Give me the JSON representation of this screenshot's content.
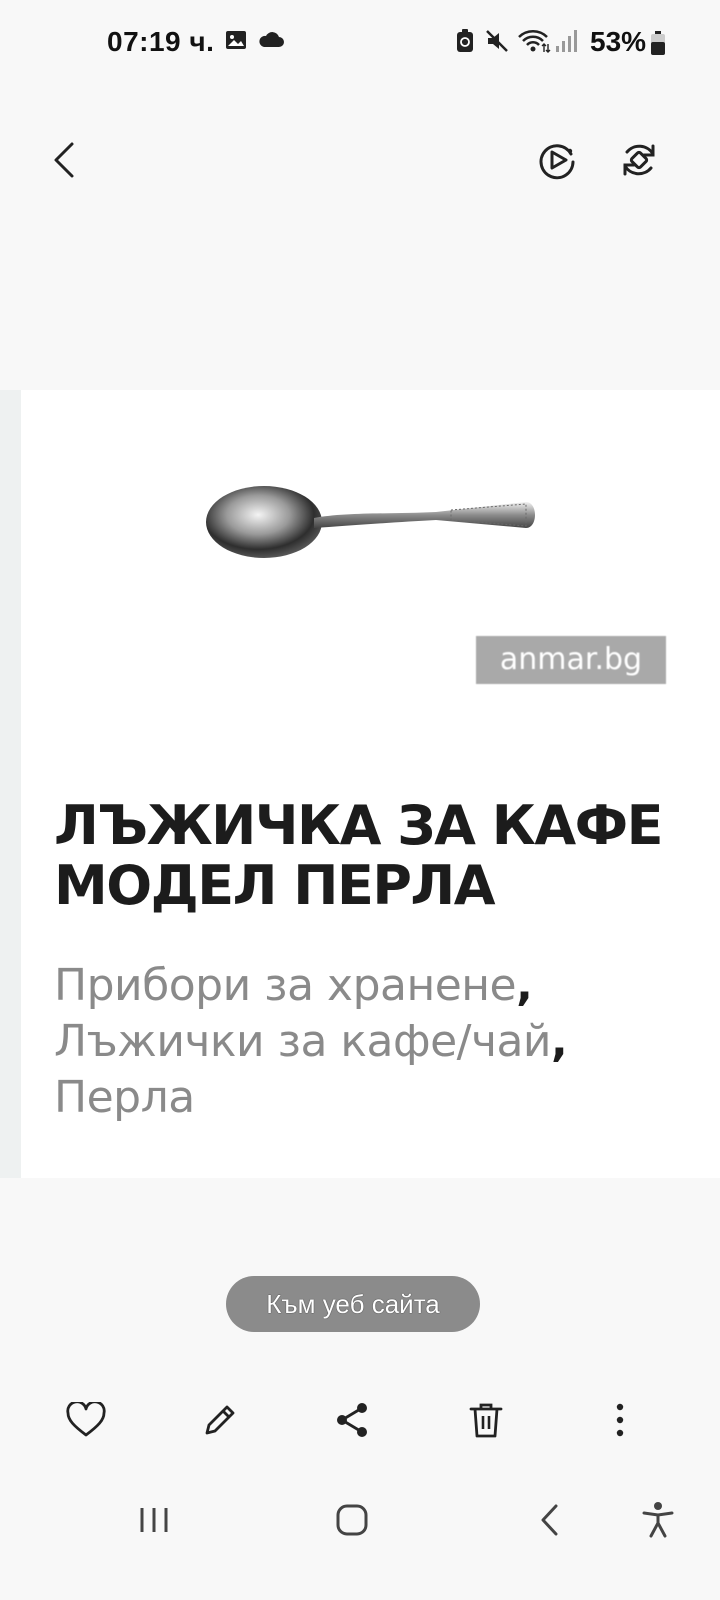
{
  "status_bar": {
    "time": "07:19 ч.",
    "battery_percent": "53%",
    "icons": [
      "gallery-icon",
      "cloud-icon",
      "battery-saver-icon",
      "mute-icon",
      "wifi-icon",
      "signal-icon",
      "battery-icon"
    ]
  },
  "top_bar": {
    "icons": [
      "back-icon",
      "motion-photo-icon",
      "rotate-icon"
    ]
  },
  "photo": {
    "watermark": "anmar.bg",
    "title_line1": "ЛЪЖИЧКА ЗА КАФЕ",
    "title_line2": "МОДЕЛ ПЕРЛА",
    "categories": [
      "Прибори за хранене",
      "Лъжички за кафе/чай",
      "Перла"
    ],
    "separator": ","
  },
  "web_button": {
    "label": "Към уеб сайта"
  },
  "actions": {
    "icons": [
      "favorite-icon",
      "edit-icon",
      "share-icon",
      "delete-icon",
      "more-icon"
    ]
  },
  "nav_bar": {
    "icons": [
      "recents-icon",
      "home-icon",
      "back-icon",
      "accessibility-icon"
    ]
  },
  "colors": {
    "background": "#f8f8f8",
    "pill": "#8b8b8b",
    "title": "#1c1c1c",
    "category": "#8a8a8a"
  }
}
